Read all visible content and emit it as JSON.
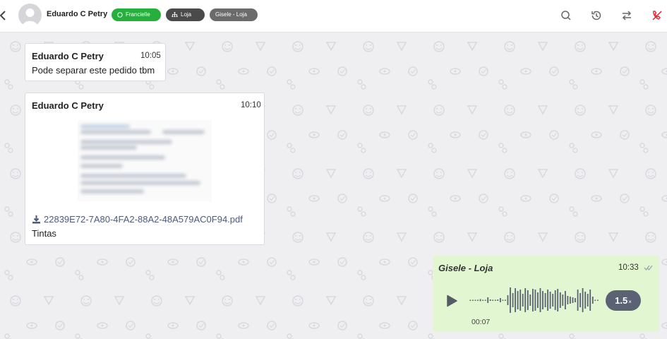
{
  "header": {
    "contact_name": "Eduardo C Petry",
    "tags": [
      {
        "label": "Francielle",
        "icon": "whatsapp-icon",
        "color": "#25b03c"
      },
      {
        "label": "Loja",
        "icon": "sitemap-icon",
        "color": "#4a4a4a"
      },
      {
        "label": "Gisele - Loja",
        "icon": "",
        "color": "#6b6b6b"
      }
    ],
    "toolbar_icons": [
      "search-icon",
      "history-icon",
      "transfer-icon",
      "end-call-icon"
    ]
  },
  "messages": [
    {
      "sender": "Eduardo C Petry",
      "time": "10:05",
      "text": "Pode separar este pedido tbm"
    },
    {
      "sender": "Eduardo C Petry",
      "time": "10:10",
      "file_name": "22839E72-7A80-4FA2-88A2-48A579AC0F94.pdf",
      "caption": "Tintas"
    },
    {
      "sender": "Gisele - Loja",
      "time": "10:33",
      "audio_duration": "00:07",
      "playback_speed": "1.5",
      "speed_suffix": "×"
    }
  ],
  "colors": {
    "outgoing_bubble": "#e2f6d1",
    "chat_background": "#efeff2",
    "end_call_icon": "#e0242f"
  }
}
